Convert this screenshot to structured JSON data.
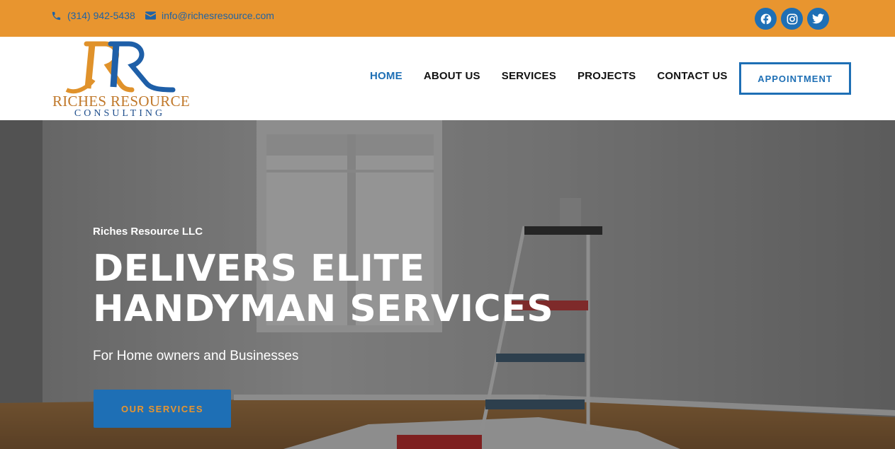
{
  "topbar": {
    "phone": "(314) 942-5438",
    "email": "info@richesresource.com",
    "phone_icon": "phone-icon",
    "email_icon": "envelope-icon",
    "social": [
      "facebook-icon",
      "instagram-icon",
      "twitter-icon"
    ]
  },
  "logo": {
    "monogram": "RR",
    "line1": "RICHES RESOURCE",
    "line2": "CONSULTING"
  },
  "nav": {
    "items": [
      "HOME",
      "ABOUT US",
      "SERVICES",
      "PROJECTS",
      "CONTACT US"
    ],
    "active": "HOME",
    "appointment_label": "APPOINTMENT"
  },
  "hero": {
    "eyebrow": "Riches Resource LLC",
    "headline_line1": "DELIVERS ELITE",
    "headline_line2": "HANDYMAN SERVICES",
    "subheading": "For Home owners and Businesses",
    "cta_label": "OUR SERVICES"
  },
  "colors": {
    "topbar": "#E8952F",
    "brand_blue": "#1E6FB5",
    "logo_gold": "#C0782A",
    "logo_navy": "#1E4E8C"
  }
}
